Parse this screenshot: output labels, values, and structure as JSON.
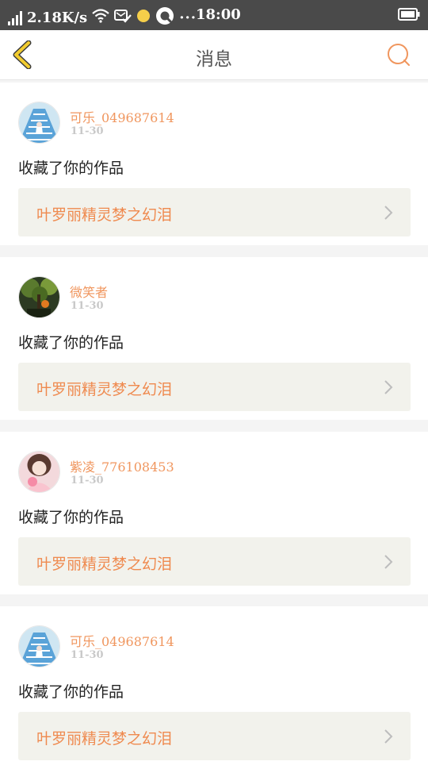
{
  "status_bar": {
    "network_speed": "2.18K/s",
    "time": "18:00",
    "overflow_dots": "···"
  },
  "header": {
    "title": "消息"
  },
  "notifications": [
    {
      "username": "可乐_049687614",
      "date": "11-30",
      "action": "收藏了你的作品",
      "work_title": "叶罗丽精灵梦之幻泪",
      "avatar": "blue-stairs-girl"
    },
    {
      "username": "微笑者",
      "date": "11-30",
      "action": "收藏了你的作品",
      "work_title": "叶罗丽精灵梦之幻泪",
      "avatar": "tree-dark"
    },
    {
      "username": "紫凌_776108453",
      "date": "11-30",
      "action": "收藏了你的作品",
      "work_title": "叶罗丽精灵梦之幻泪",
      "avatar": "pink-girl"
    },
    {
      "username": "可乐_049687614",
      "date": "11-30",
      "action": "收藏了你的作品",
      "work_title": "叶罗丽精灵梦之幻泪",
      "avatar": "blue-stairs-girl"
    }
  ],
  "colors": {
    "accent_orange": "#f0965e",
    "status_bar_bg": "#4a4a4a",
    "back_arrow": "#f2cc2f"
  }
}
